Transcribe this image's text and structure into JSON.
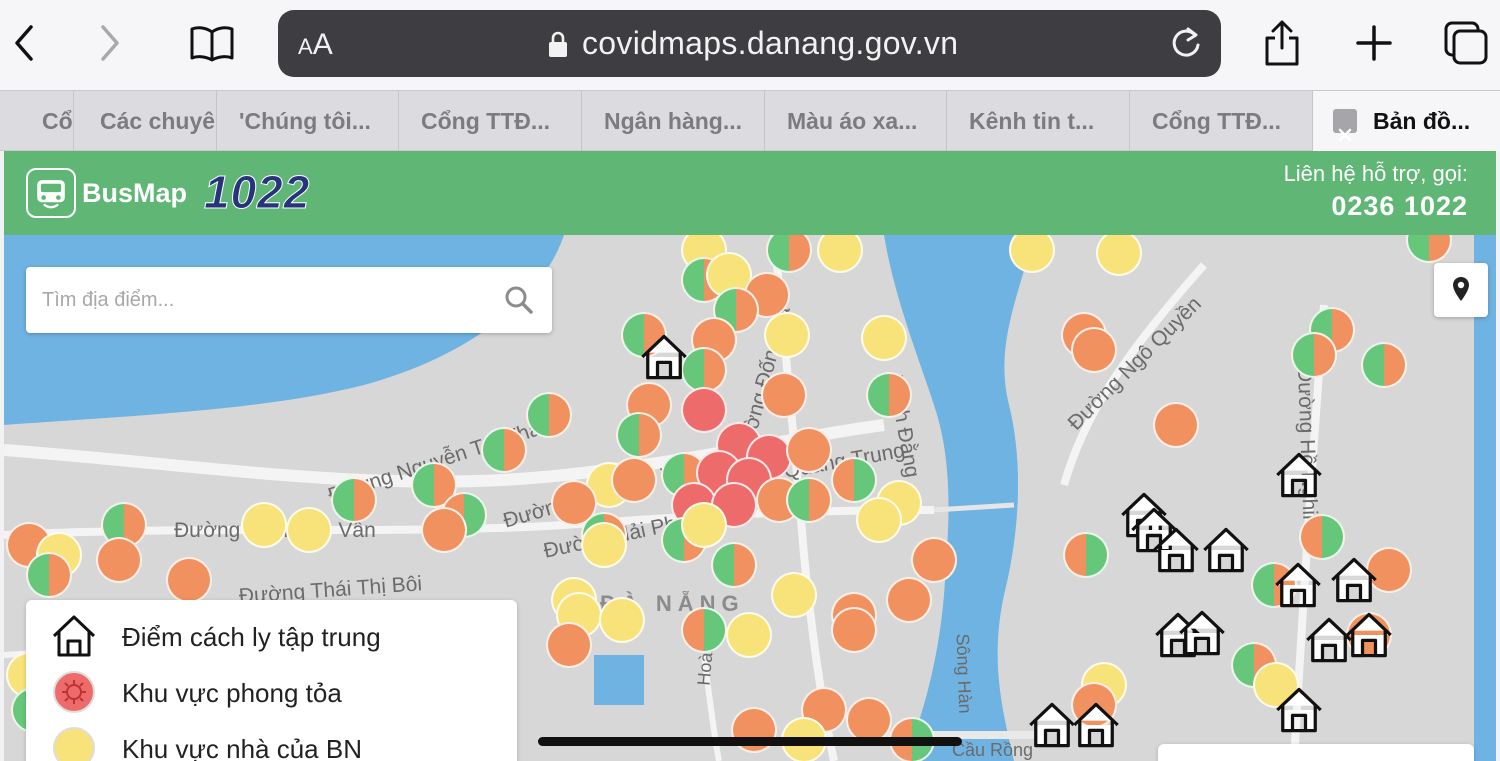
{
  "browser": {
    "address_size_label": "AA",
    "url": "covidmaps.danang.gov.vn",
    "tabs": [
      {
        "label": "Cổ"
      },
      {
        "label": "Các chuyê"
      },
      {
        "label": "'Chúng tôi..."
      },
      {
        "label": "Cổng TTĐ..."
      },
      {
        "label": "Ngân hàng..."
      },
      {
        "label": "Màu áo xa..."
      },
      {
        "label": "Kênh tin t..."
      },
      {
        "label": "Cổng TTĐ..."
      },
      {
        "label": "Bản đồ..."
      }
    ],
    "active_tab_index": 8
  },
  "header": {
    "brand": "BusMap",
    "hotline_logo": "1022",
    "support_label": "Liên hệ hỗ trợ, gọi:",
    "support_phone": "0236 1022",
    "background_color": "#5fb675"
  },
  "search": {
    "placeholder": "Tìm địa điểm..."
  },
  "map": {
    "district_label": "ĐÀ NẴNG",
    "street_labels": [
      "Đường Nguyễn Tất Thành",
      "Đường Trần Cao Vân",
      "Đường Thái Thị Bôi",
      "Đường Trần Cao Vân",
      "Đường Hải Phòng",
      "Đường Đống Đa",
      "Bạch Đằng",
      "Quang Trung",
      "Đường Ngô Quyền",
      "Đường Hồ Nghinh",
      "Sông Hàn",
      "Cầu Rồng",
      "Hoàng"
    ],
    "marker_colors": {
      "yellow": "#f7e37a",
      "orange": "#f0915f",
      "green": "#66c77a",
      "red": "#ee6b6b"
    }
  },
  "legend": {
    "items": [
      {
        "label": "Điểm cách ly tập trung",
        "icon": "house-icon"
      },
      {
        "label": "Khu vực phong tỏa",
        "icon": "virus-icon"
      },
      {
        "label": "Khu vực nhà của BN",
        "icon": "yellow-dot-icon"
      }
    ]
  }
}
